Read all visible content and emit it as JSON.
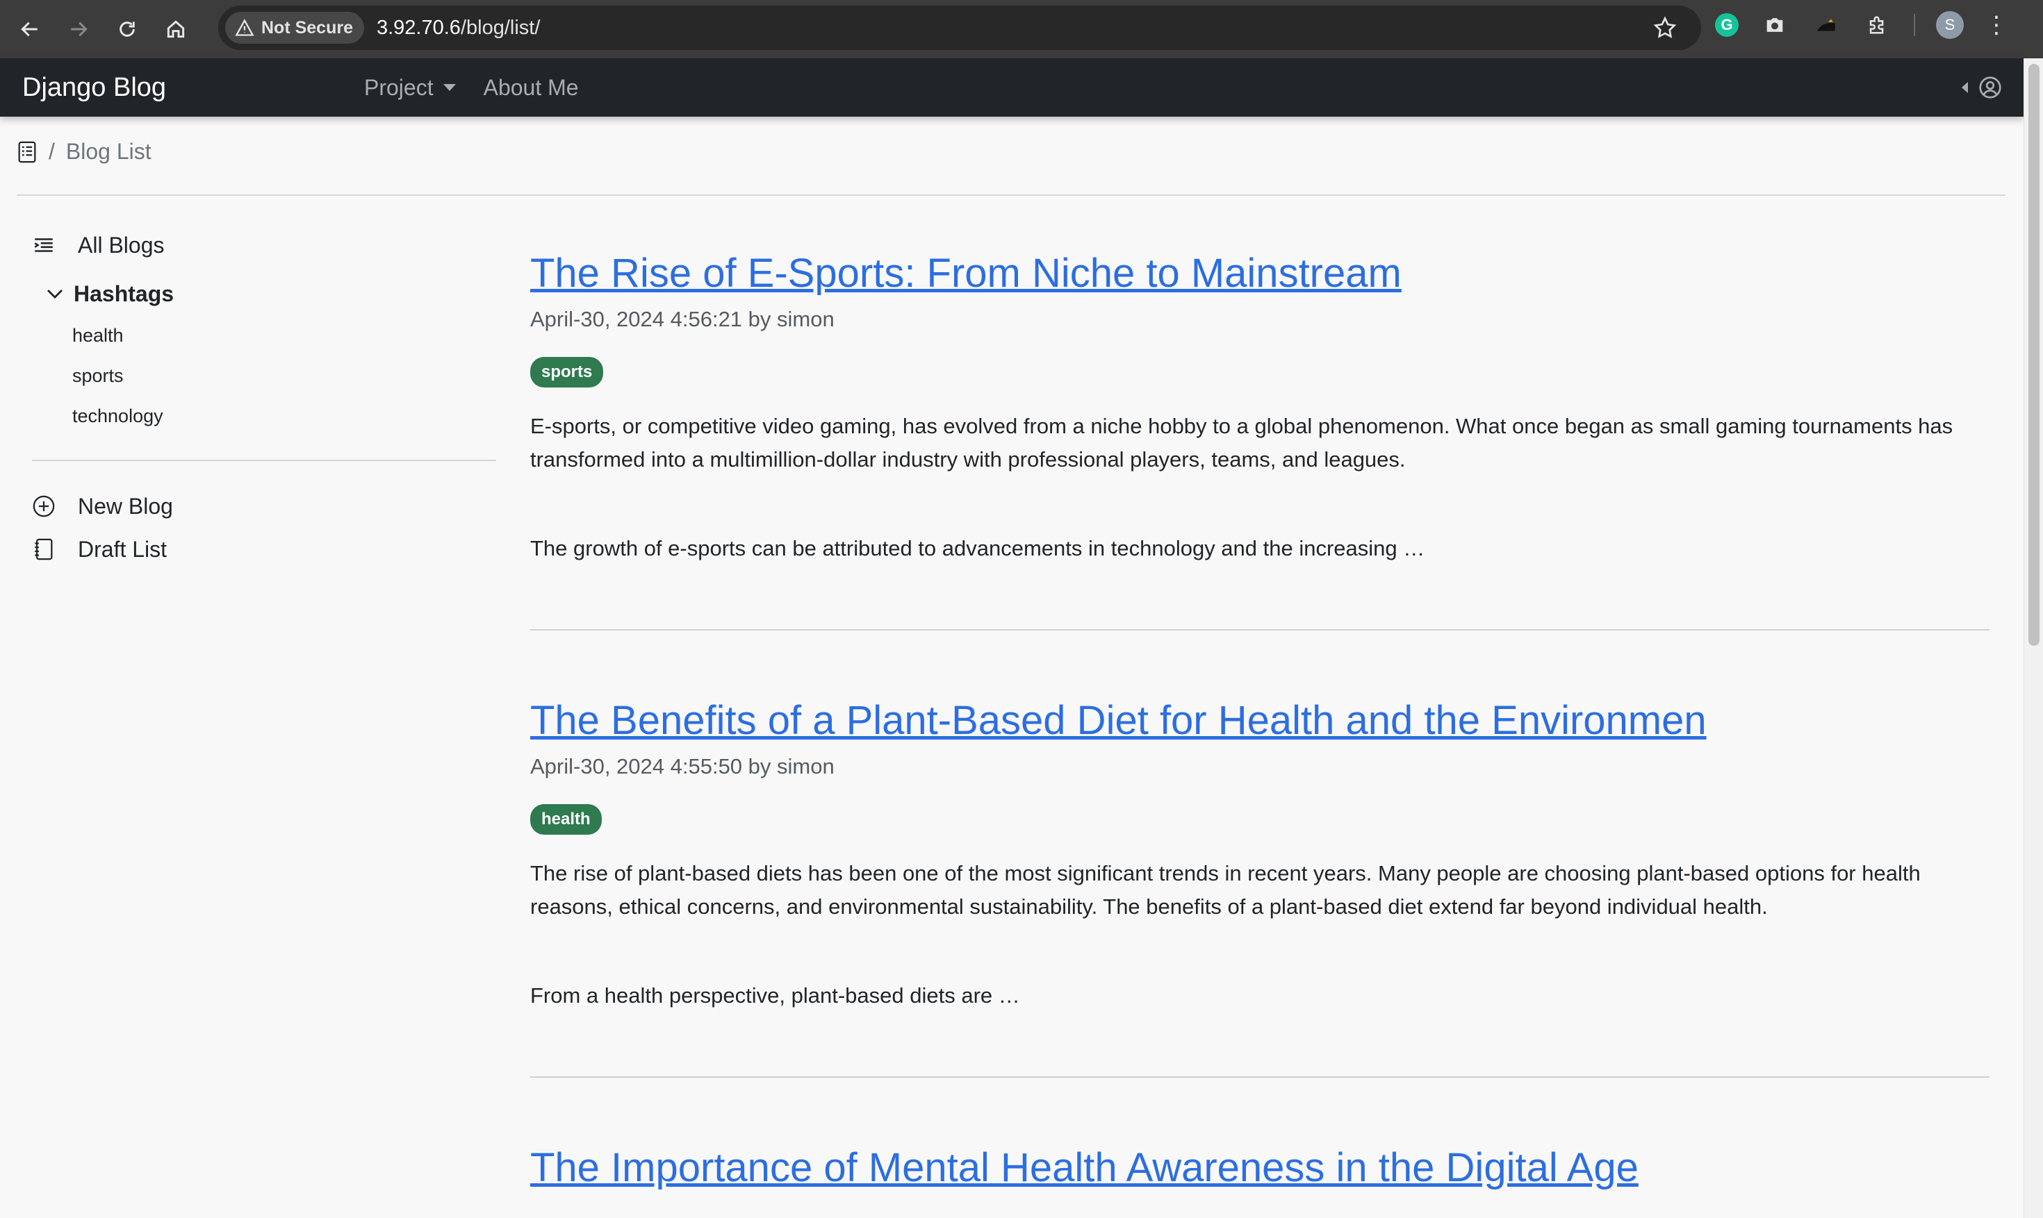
{
  "browser": {
    "security_label": "Not Secure",
    "url_host": "3.92.70.6",
    "url_path": "/blog/list/",
    "profile_initial": "S",
    "grammarly_letter": "G"
  },
  "app": {
    "brand": "Django Blog",
    "nav": {
      "project": "Project",
      "about": "About Me"
    }
  },
  "breadcrumb": {
    "separator": "/",
    "current": "Blog List"
  },
  "sidebar": {
    "all_blogs": "All Blogs",
    "hashtags_heading": "Hashtags",
    "hashtags": [
      "health",
      "sports",
      "technology"
    ],
    "new_blog": "New Blog",
    "draft_list": "Draft List"
  },
  "posts": [
    {
      "title": "The Rise of E-Sports: From Niche to Mainstream",
      "meta": "April-30, 2024 4:56:21 by simon",
      "tag": "sports",
      "para1": "E-sports, or competitive video gaming, has evolved from a niche hobby to a global phenomenon. What once began as small gaming tournaments has transformed into a multimillion-dollar industry with professional players, teams, and leagues.",
      "para2": "The growth of e-sports can be attributed to advancements in technology and the increasing …"
    },
    {
      "title": "The Benefits of a Plant-Based Diet for Health and the Environmen",
      "meta": "April-30, 2024 4:55:50 by simon",
      "tag": "health",
      "para1": "The rise of plant-based diets has been one of the most significant trends in recent years. Many people are choosing plant-based options for health reasons, ethical concerns, and environmental sustainability. The benefits of a plant-based diet extend far beyond individual health.",
      "para2": "From a health perspective, plant-based diets are …"
    },
    {
      "title": "The Importance of Mental Health Awareness in the Digital Age"
    }
  ],
  "colors": {
    "link": "#2c6ee0",
    "badge": "#2f7a4f",
    "navbar": "#212529"
  }
}
